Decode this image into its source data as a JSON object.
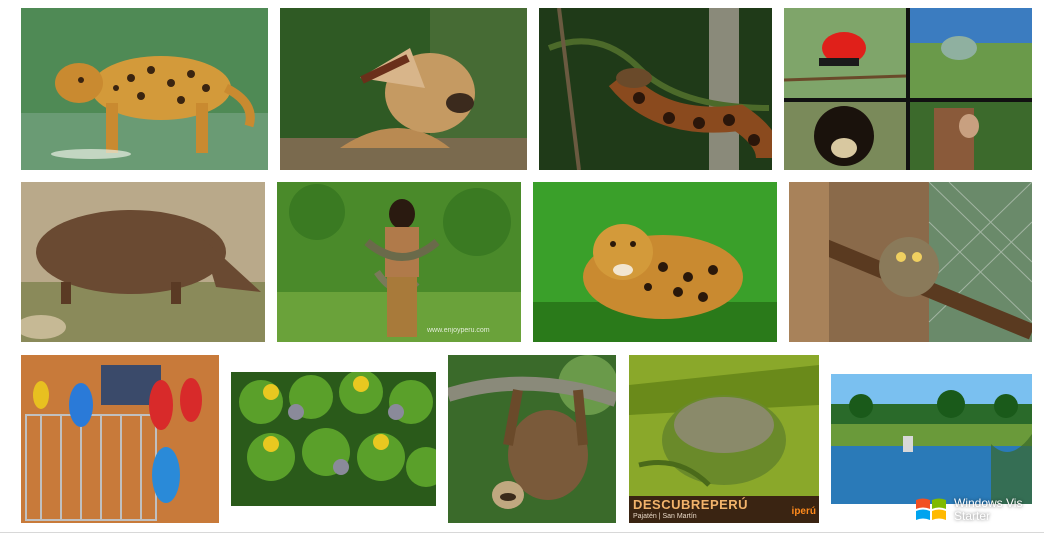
{
  "images": [
    {
      "subject": "jaguar-in-water"
    },
    {
      "subject": "puma-roaring"
    },
    {
      "subject": "anaconda-on-tree"
    },
    {
      "subject": "wildlife-collage"
    },
    {
      "subject": "peccary"
    },
    {
      "subject": "person-with-snakes"
    },
    {
      "subject": "jaguar-crouching"
    },
    {
      "subject": "night-monkey"
    },
    {
      "subject": "macaws-on-cage"
    },
    {
      "subject": "parrots-group"
    },
    {
      "subject": "sloth-hanging"
    },
    {
      "subject": "mossy-rock"
    },
    {
      "subject": "lake-landscape"
    }
  ],
  "captions": {
    "person_watermark": "www.enjoyperu.com",
    "descubre_title": "DESCUBREPERÚ",
    "descubre_sub": "Pajatén | San Martín",
    "descubre_logo": "iperú"
  },
  "os_watermark": {
    "line1": "Windows Vis",
    "line2": "Starter"
  },
  "colors": {
    "jungle_green": "#3f7a2a",
    "water_teal": "#4e8a84",
    "caption_brown": "#3a2412"
  }
}
